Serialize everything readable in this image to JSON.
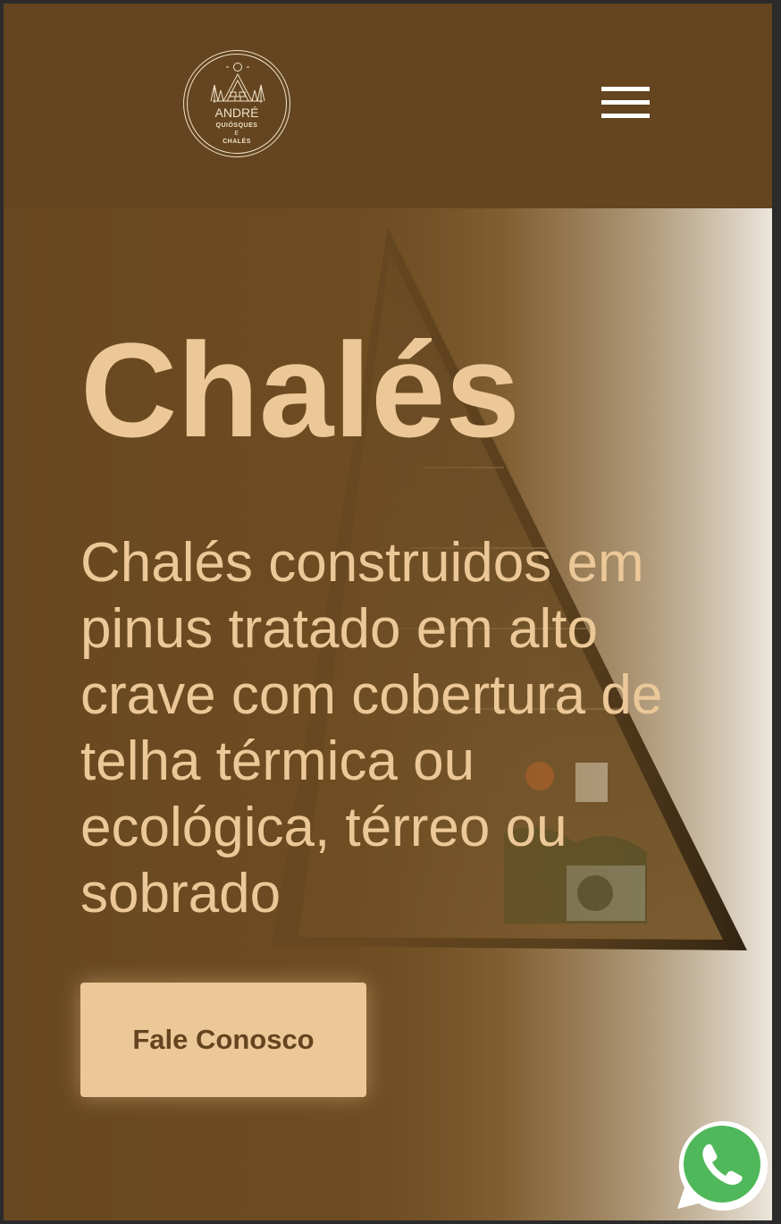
{
  "header": {
    "logo": {
      "name": "ANDRÉ",
      "line1": "QUIÓSQUES",
      "line2": "E",
      "line3": "CHALÉS"
    },
    "menu_icon": "hamburger-menu-icon"
  },
  "hero": {
    "title": "Chalés",
    "description": "Chalés construidos em pinus tratado em alto crave com cobertura de telha térmica ou ecológica, térreo ou sobrado",
    "cta_label": "Fale Conosco"
  },
  "floating": {
    "whatsapp_icon": "whatsapp-icon"
  },
  "colors": {
    "brand_brown": "#644520",
    "accent_beige": "#ecc898",
    "whatsapp_green": "#4fb85a"
  }
}
